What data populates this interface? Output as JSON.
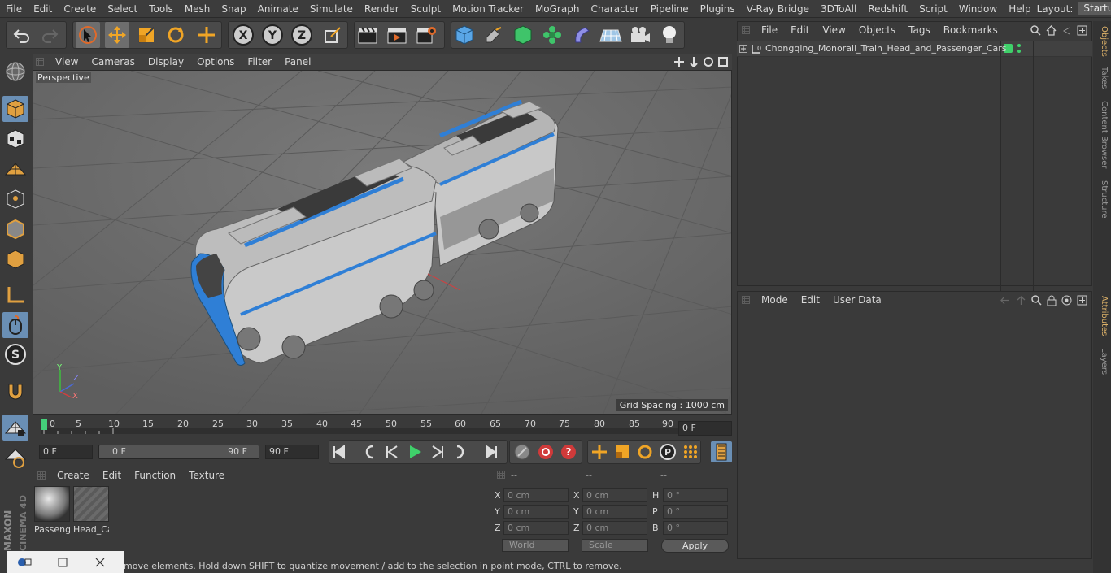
{
  "menubar": {
    "items": [
      "File",
      "Edit",
      "Create",
      "Select",
      "Tools",
      "Mesh",
      "Snap",
      "Animate",
      "Simulate",
      "Render",
      "Sculpt",
      "Motion Tracker",
      "MoGraph",
      "Character",
      "Pipeline",
      "Plugins",
      "V-Ray Bridge",
      "3DToAll",
      "Redshift",
      "Script",
      "Window",
      "Help"
    ],
    "layout_label": "Layout:",
    "layout_value": "Startup"
  },
  "viewport": {
    "menu": [
      "View",
      "Cameras",
      "Display",
      "Options",
      "Filter",
      "Panel"
    ],
    "label": "Perspective",
    "grid_spacing": "Grid Spacing : 1000 cm",
    "axes": {
      "y": "Y",
      "z": "Z",
      "x": "X"
    }
  },
  "timeline": {
    "ticks": [
      "0",
      "5",
      "10",
      "15",
      "20",
      "25",
      "30",
      "35",
      "40",
      "45",
      "50",
      "55",
      "60",
      "65",
      "70",
      "75",
      "80",
      "85",
      "90"
    ],
    "current_frame": "0 F"
  },
  "transport": {
    "start": "0 F",
    "range_start": "0 F",
    "range_end": "90 F",
    "end": "90 F"
  },
  "materials": {
    "menu": [
      "Create",
      "Edit",
      "Function",
      "Texture"
    ],
    "items": [
      {
        "name": "Passeng"
      },
      {
        "name": "Head_Ca"
      }
    ]
  },
  "coords": {
    "headers": [
      "--",
      "--",
      "--"
    ],
    "rows": [
      {
        "a": "X",
        "av": "0 cm",
        "b": "X",
        "bv": "0 cm",
        "c": "H",
        "cv": "0 °"
      },
      {
        "a": "Y",
        "av": "0 cm",
        "b": "Y",
        "bv": "0 cm",
        "c": "P",
        "cv": "0 °"
      },
      {
        "a": "Z",
        "av": "0 cm",
        "b": "Z",
        "bv": "0 cm",
        "c": "B",
        "cv": "0 °"
      }
    ],
    "world": "World",
    "scale": "Scale",
    "apply": "Apply"
  },
  "objects": {
    "menu": [
      "File",
      "Edit",
      "View",
      "Objects",
      "Tags",
      "Bookmarks"
    ],
    "root": "Chongqing_Monorail_Train_Head_and_Passenger_Cars"
  },
  "attributes": {
    "menu": [
      "Mode",
      "Edit",
      "User Data"
    ]
  },
  "right_tabs": [
    "Objects",
    "Takes",
    "Content Browser",
    "Structure",
    "Attributes",
    "Layers"
  ],
  "status": "move elements. Hold down SHIFT to quantize movement / add to the selection in point mode, CTRL to remove.",
  "brand": {
    "line1": "MAXON",
    "line2": "CINEMA 4D"
  },
  "colors": {
    "accent": "#6a8fb5",
    "train_blue": "#2f7fd6",
    "selection": "#e0b46a"
  }
}
